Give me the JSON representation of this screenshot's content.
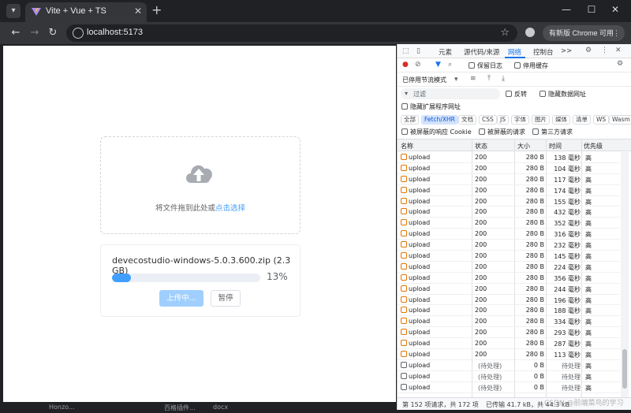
{
  "browser": {
    "tab_title": "Vite + Vue + TS",
    "url": "localhost:5173",
    "update_label": "有新版 Chrome 可用"
  },
  "page": {
    "drop_text": "将文件拖到此处或",
    "drop_link": "点击选择",
    "file_name": "devecostudio-windows-5.0.3.600.zip (2.3 GB)",
    "progress_percent": 13,
    "progress_label": "13%",
    "upload_button": "上传中...",
    "pause_button": "暂停"
  },
  "devtools": {
    "tabs": [
      "元素",
      "源代码/来源",
      "网络",
      "控制台"
    ],
    "active_tab": "网络",
    "more": ">>",
    "toolbar": {
      "preserve_log": "保留日志",
      "disable_cache": "停用缓存",
      "throttle": "已停用节流模式"
    },
    "filter": {
      "placeholder": "过滤",
      "invert": "反转",
      "hide_data_urls": "隐藏数据网址",
      "hide_ext_urls": "隐藏扩展程序网址"
    },
    "type_filters": [
      "全部",
      "Fetch/XHR",
      "文档",
      "CSS",
      "JS",
      "字体",
      "图片",
      "媒体",
      "清单",
      "WS",
      "Wasm"
    ],
    "active_type": "Fetch/XHR",
    "cookie_filters": {
      "blocked_cookies": "被屏蔽的响应 Cookie",
      "blocked_requests": "被屏蔽的请求",
      "third_party": "第三方请求"
    },
    "columns": {
      "name": "名称",
      "status": "状态",
      "size": "大小",
      "time": "时间",
      "priority": "优先级"
    },
    "rows": [
      {
        "name": "upload",
        "status": "200",
        "size": "280 B",
        "time": "138 毫秒",
        "priority": "高"
      },
      {
        "name": "upload",
        "status": "200",
        "size": "280 B",
        "time": "104 毫秒",
        "priority": "高"
      },
      {
        "name": "upload",
        "status": "200",
        "size": "280 B",
        "time": "117 毫秒",
        "priority": "高"
      },
      {
        "name": "upload",
        "status": "200",
        "size": "280 B",
        "time": "174 毫秒",
        "priority": "高"
      },
      {
        "name": "upload",
        "status": "200",
        "size": "280 B",
        "time": "155 毫秒",
        "priority": "高"
      },
      {
        "name": "upload",
        "status": "200",
        "size": "280 B",
        "time": "432 毫秒",
        "priority": "高"
      },
      {
        "name": "upload",
        "status": "200",
        "size": "280 B",
        "time": "352 毫秒",
        "priority": "高"
      },
      {
        "name": "upload",
        "status": "200",
        "size": "280 B",
        "time": "316 毫秒",
        "priority": "高"
      },
      {
        "name": "upload",
        "status": "200",
        "size": "280 B",
        "time": "232 毫秒",
        "priority": "高"
      },
      {
        "name": "upload",
        "status": "200",
        "size": "280 B",
        "time": "145 毫秒",
        "priority": "高"
      },
      {
        "name": "upload",
        "status": "200",
        "size": "280 B",
        "time": "224 毫秒",
        "priority": "高"
      },
      {
        "name": "upload",
        "status": "200",
        "size": "280 B",
        "time": "356 毫秒",
        "priority": "高"
      },
      {
        "name": "upload",
        "status": "200",
        "size": "280 B",
        "time": "244 毫秒",
        "priority": "高"
      },
      {
        "name": "upload",
        "status": "200",
        "size": "280 B",
        "time": "196 毫秒",
        "priority": "高"
      },
      {
        "name": "upload",
        "status": "200",
        "size": "280 B",
        "time": "188 毫秒",
        "priority": "高"
      },
      {
        "name": "upload",
        "status": "200",
        "size": "280 B",
        "time": "334 毫秒",
        "priority": "高"
      },
      {
        "name": "upload",
        "status": "200",
        "size": "280 B",
        "time": "293 毫秒",
        "priority": "高"
      },
      {
        "name": "upload",
        "status": "200",
        "size": "280 B",
        "time": "287 毫秒",
        "priority": "高"
      },
      {
        "name": "upload",
        "status": "200",
        "size": "280 B",
        "time": "113 毫秒",
        "priority": "高"
      },
      {
        "name": "upload",
        "status": "(待处理)",
        "size": "0 B",
        "time": "待处理",
        "priority": "高",
        "pending": true
      },
      {
        "name": "upload",
        "status": "(待处理)",
        "size": "0 B",
        "time": "待处理",
        "priority": "高",
        "pending": true
      },
      {
        "name": "upload",
        "status": "(待处理)",
        "size": "0 B",
        "time": "待处理",
        "priority": "高",
        "pending": true
      }
    ],
    "statusbar": {
      "requests": "第 152 项请求，共 172 项",
      "transferred": "已传输 41.7 kB，共 44.3 kB"
    }
  },
  "taskbar": {
    "items": [
      "Honzo...",
      "百格插件...",
      "docx"
    ]
  },
  "watermark": "CSDN @前端菜鸟的学习"
}
